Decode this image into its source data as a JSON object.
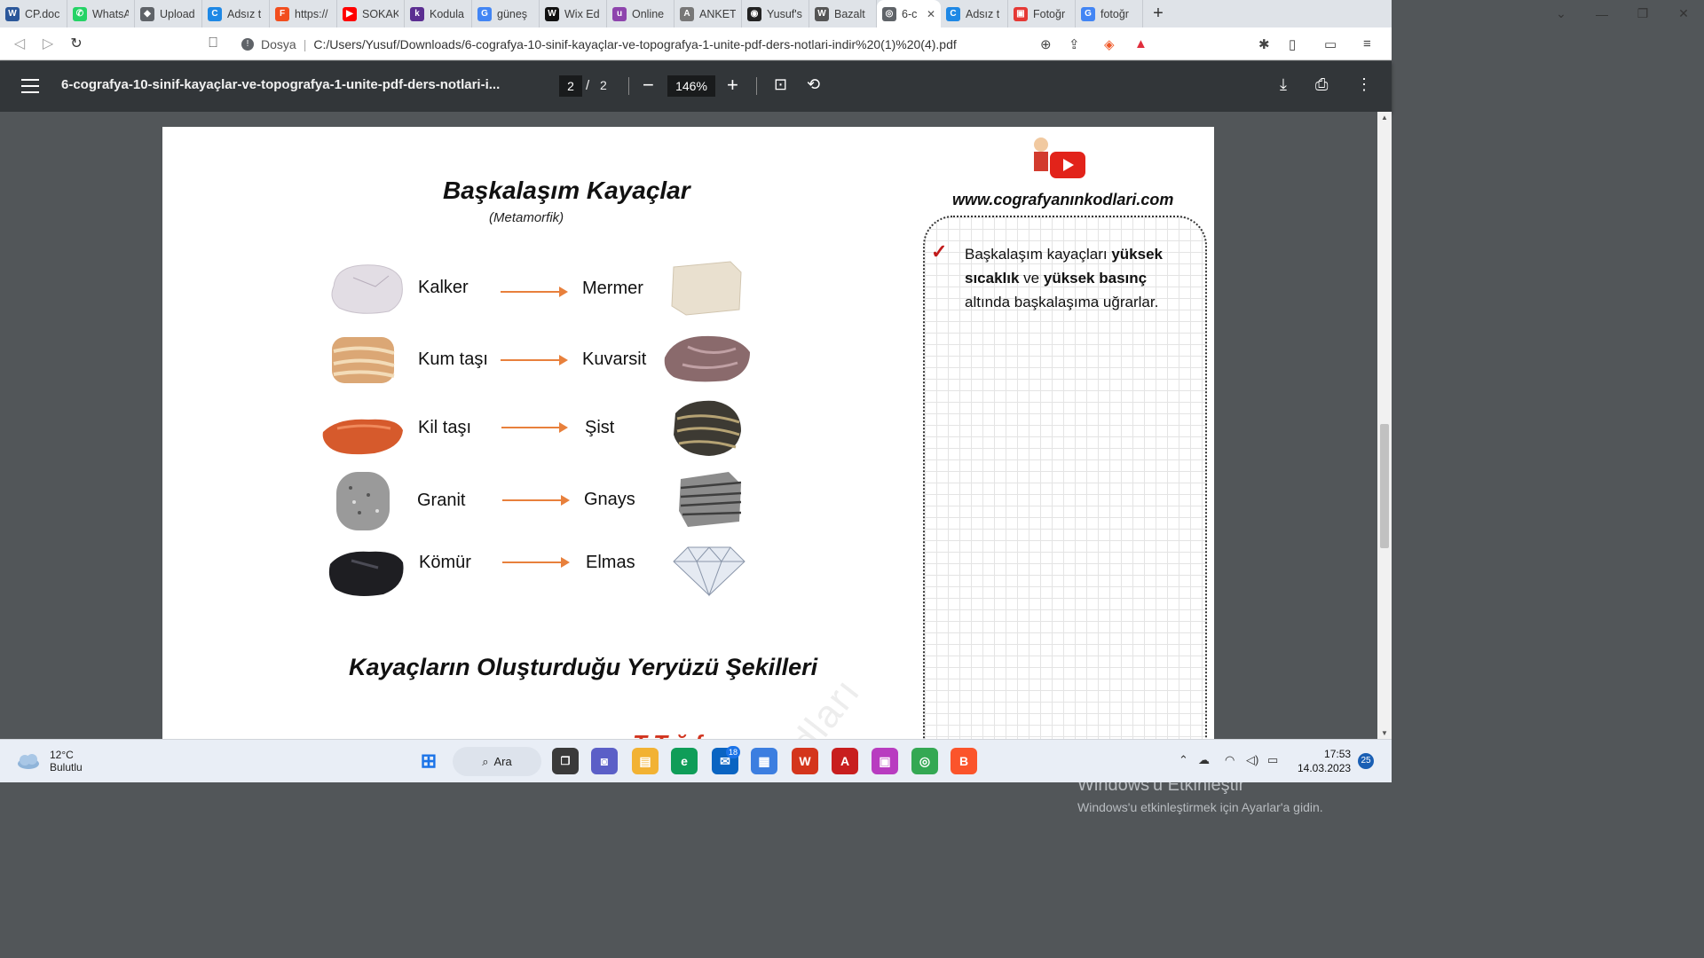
{
  "tabs": [
    {
      "title": "CP.doc",
      "color": "#2b579a",
      "glyph": "W"
    },
    {
      "title": "WhatsA",
      "color": "#25d366",
      "glyph": "✆"
    },
    {
      "title": "Upload",
      "color": "#5f6368",
      "glyph": "◆"
    },
    {
      "title": "Adsız t",
      "color": "#1e88e5",
      "glyph": "C"
    },
    {
      "title": "https://",
      "color": "#f24e1e",
      "glyph": "F"
    },
    {
      "title": "SOKAK",
      "color": "#ff0000",
      "glyph": "▶"
    },
    {
      "title": "Kodula",
      "color": "#5b2e91",
      "glyph": "k"
    },
    {
      "title": "güneş",
      "color": "#4285f4",
      "glyph": "G"
    },
    {
      "title": "Wix Ed",
      "color": "#111111",
      "glyph": "W"
    },
    {
      "title": "Online",
      "color": "#8e44ad",
      "glyph": "u"
    },
    {
      "title": "ANKET",
      "color": "#777777",
      "glyph": "A"
    },
    {
      "title": "Yusuf's",
      "color": "#222222",
      "glyph": "◉"
    },
    {
      "title": "Bazalt",
      "color": "#555555",
      "glyph": "W"
    },
    {
      "title": "6-c",
      "color": "#5f6368",
      "glyph": "◎"
    },
    {
      "title": "Adsız t",
      "color": "#1e88e5",
      "glyph": "C"
    },
    {
      "title": "Fotoğr",
      "color": "#e53935",
      "glyph": "▣"
    },
    {
      "title": "fotoğr",
      "color": "#4285f4",
      "glyph": "G"
    }
  ],
  "address": {
    "scheme_label": "Dosya",
    "url": "C:/Users/Yusuf/Downloads/6-cografya-10-sinif-kayaçlar-ve-topografya-1-unite-pdf-ders-notlari-indir%20(1)%20(4).pdf"
  },
  "pdf_toolbar": {
    "title": "6-cografya-10-sinif-kayaçlar-ve-topografya-1-unite-pdf-ders-notlari-i...",
    "current_page": "2",
    "page_separator": "/",
    "total_pages": "2",
    "zoom": "146%"
  },
  "document": {
    "heading": "Başkalaşım Kayaçlar",
    "subheading": "(Metamorfik)",
    "pairs": [
      {
        "from": "Kalker",
        "to": "Mermer"
      },
      {
        "from": "Kum taşı",
        "to": "Kuvarsit"
      },
      {
        "from": "Kil taşı",
        "to": "Şist"
      },
      {
        "from": "Granit",
        "to": "Gnays"
      },
      {
        "from": "Kömür",
        "to": "Elmas"
      }
    ],
    "section_heading": "Kayaçların Oluşturduğu Yeryüzü Şekilleri",
    "website": "www.cografyanınkodlari.com",
    "note_parts": [
      "Başkalaşım kayaçları ",
      "yüksek sıcaklık",
      " ve ",
      "yüksek basınç",
      " altında başkalaşıma uğrarlar."
    ],
    "partial_red_text": "T T ğ f",
    "watermark": "dları"
  },
  "activation": {
    "title": "Windows'u Etkinleştir",
    "subtitle": "Windows'u etkinleştirmek için Ayarlar'a gidin."
  },
  "taskbar": {
    "temperature": "12°C",
    "weather": "Bulutlu",
    "search_label": "Ara",
    "mail_badge": "18",
    "time": "17:53",
    "date": "14.03.2023",
    "notification_count": "25"
  }
}
